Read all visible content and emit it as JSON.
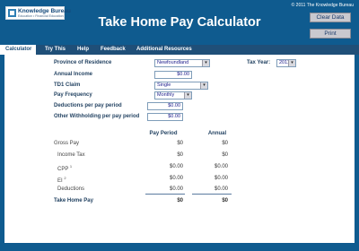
{
  "header": {
    "logo_name": "Knowledge Bureau",
    "logo_tagline": "Education • Financial Education",
    "title": "Take Home Pay Calculator",
    "copyright": "© 2011 The Knowledge Bureau",
    "clear_label": "Clear Data",
    "print_label": "Print"
  },
  "tabs": [
    {
      "label": "Calculator",
      "active": true
    },
    {
      "label": "Try This",
      "active": false
    },
    {
      "label": "Help",
      "active": false
    },
    {
      "label": "Feedback",
      "active": false
    },
    {
      "label": "Additional Resources",
      "active": false
    }
  ],
  "form": {
    "province_label": "Province of Residence",
    "province_value": "Newfoundland",
    "tax_year_label": "Tax Year:",
    "tax_year_value": "2011",
    "annual_income_label": "Annual Income",
    "annual_income_value": "$0.00",
    "td1_label": "TD1 Claim",
    "td1_value": "Single",
    "frequency_label": "Pay Frequency",
    "frequency_value": "Monthly",
    "deductions_label": "Deductions per pay period",
    "deductions_value": "$0.00",
    "other_label": "Other Withholding per pay period",
    "other_value": "$0.00"
  },
  "results": {
    "col_period": "Pay Period",
    "col_annual": "Annual",
    "rows": [
      {
        "label": "Gross Pay",
        "sup": "",
        "period": "$0",
        "annual": "$0"
      },
      {
        "label": "Income Tax",
        "sup": "",
        "period": "$0",
        "annual": "$0"
      },
      {
        "label": "CPP",
        "sup": "1",
        "period": "$0.00",
        "annual": "$0.00"
      },
      {
        "label": "EI",
        "sup": "2",
        "period": "$0.00",
        "annual": "$0.00"
      },
      {
        "label": "Deductions",
        "sup": "",
        "period": "$0.00",
        "annual": "$0.00"
      }
    ],
    "take_home_label": "Take Home Pay",
    "take_home_period": "$0",
    "take_home_annual": "$0"
  },
  "colors": {
    "header_bg": "#0f5b8f",
    "tab_bar": "#1f4f78",
    "label_text": "#1f3f5f"
  }
}
